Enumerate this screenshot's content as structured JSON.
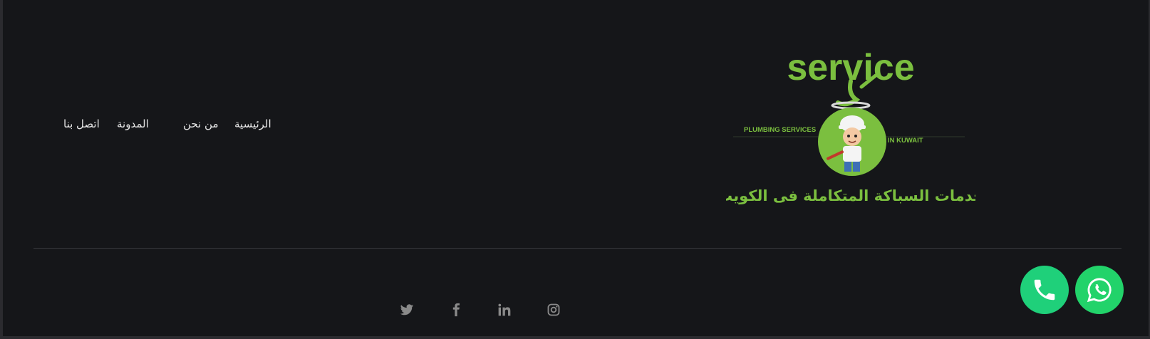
{
  "logo": {
    "wordmark": "service",
    "tagline_left": "PLUMBING SERVICES",
    "tagline_right": "IN KUWAIT",
    "arabic_title": "خدمات السباكة المتكاملة فى الكويت"
  },
  "nav": {
    "items": [
      {
        "label": "الرئيسية"
      },
      {
        "label": "من نحن"
      },
      {
        "label": "المدونة"
      },
      {
        "label": "اتصل بنا"
      }
    ]
  },
  "social": [
    {
      "icon": "twitter-icon"
    },
    {
      "icon": "facebook-icon"
    },
    {
      "icon": "linkedin-icon"
    },
    {
      "icon": "instagram-icon"
    }
  ],
  "floating_buttons": [
    {
      "icon": "phone-icon",
      "color": "#1fd07a"
    },
    {
      "icon": "whatsapp-icon",
      "color": "#22d36a"
    }
  ],
  "colors": {
    "background": "#151619",
    "logo_green": "#7bbf3f",
    "nav_text": "#e8e8e8",
    "social_icon": "#8a8a8a"
  }
}
